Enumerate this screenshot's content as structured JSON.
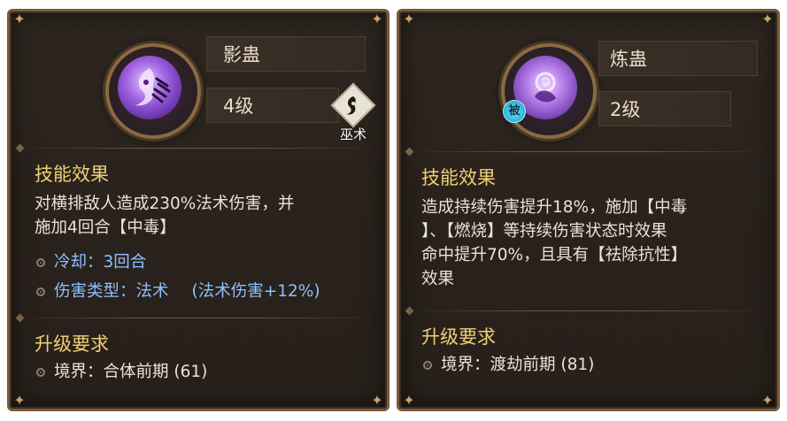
{
  "cards": [
    {
      "name": "影蛊",
      "level": "4级",
      "school_label": "巫术",
      "school_icon": "wu-shu-glyph",
      "effect_title": "技能效果",
      "effect_lines": [
        "对横排敌人造成230%法术伤害，并",
        "施加4回合【中毒】"
      ],
      "cooldown": "冷却：3回合",
      "damage_type": "伤害类型：法术",
      "damage_bonus": "(法术伤害+12%)",
      "upgrade_title": "升级要求",
      "realm_req": "境界：合体前期 (61)"
    },
    {
      "name": "炼蛊",
      "level": "2级",
      "passive_badge": "被",
      "effect_title": "技能效果",
      "effect_lines": [
        "造成持续伤害提升18%，施加【中毒",
        "】、【燃烧】等持续伤害状态时效果",
        "命中提升70%，且具有【祛除抗性】",
        "效果"
      ],
      "upgrade_title": "升级要求",
      "realm_req": "境界：渡劫前期 (81)"
    }
  ],
  "colors": {
    "title_gold": "#efcf74",
    "text_light": "#eae3d6",
    "stat_blue": "#8fc0ff",
    "panel_bg": "#2e2620",
    "frame": "#7a5a3a"
  }
}
